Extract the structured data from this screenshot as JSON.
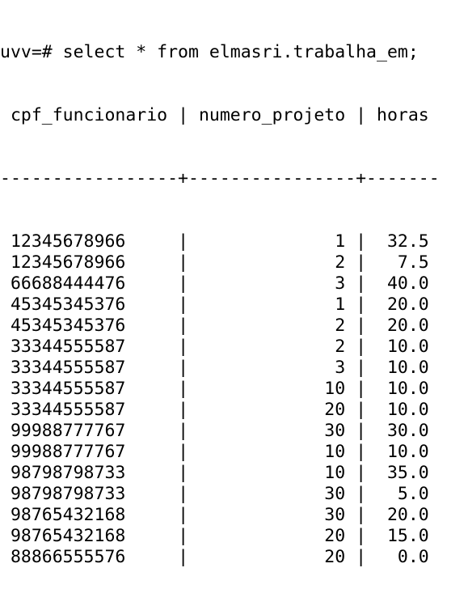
{
  "terminal": {
    "prompt": "uvv=# ",
    "command": "select * from elmasri.trabalha_em;"
  },
  "result": {
    "columns": [
      "cpf_funcionario",
      "numero_projeto",
      "horas"
    ],
    "rows": [
      [
        "12345678966",
        "1",
        "32.5"
      ],
      [
        "12345678966",
        "2",
        "7.5"
      ],
      [
        "66688444476",
        "3",
        "40.0"
      ],
      [
        "45345345376",
        "1",
        "20.0"
      ],
      [
        "45345345376",
        "2",
        "20.0"
      ],
      [
        "33344555587",
        "2",
        "10.0"
      ],
      [
        "33344555587",
        "3",
        "10.0"
      ],
      [
        "33344555587",
        "10",
        "10.0"
      ],
      [
        "33344555587",
        "20",
        "10.0"
      ],
      [
        "99988777767",
        "30",
        "30.0"
      ],
      [
        "99988777767",
        "10",
        "10.0"
      ],
      [
        "98798798733",
        "10",
        "35.0"
      ],
      [
        "98798798733",
        "30",
        "5.0"
      ],
      [
        "98765432168",
        "30",
        "20.0"
      ],
      [
        "98765432168",
        "20",
        "15.0"
      ],
      [
        "88866555576",
        "20",
        "0.0"
      ]
    ]
  }
}
